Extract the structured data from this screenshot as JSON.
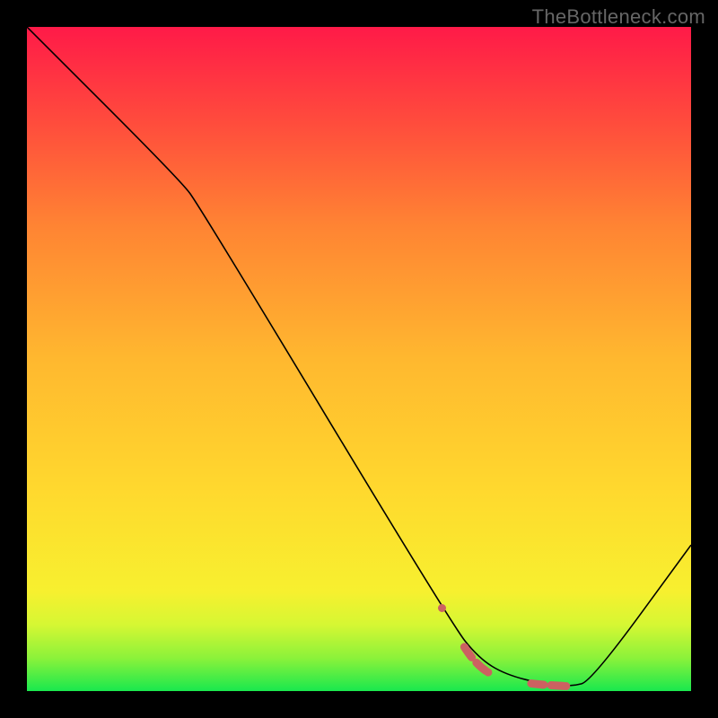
{
  "watermark": "TheBottleneck.com",
  "chart_data": {
    "type": "line",
    "title": "",
    "xlabel": "",
    "ylabel": "",
    "xlim": [
      0,
      100
    ],
    "ylim": [
      0,
      100
    ],
    "gradient_stops": [
      {
        "offset": 0.0,
        "color": "#19e84e"
      },
      {
        "offset": 0.05,
        "color": "#8cf23a"
      },
      {
        "offset": 0.1,
        "color": "#d6f733"
      },
      {
        "offset": 0.15,
        "color": "#f7f02f"
      },
      {
        "offset": 0.3,
        "color": "#ffd92e"
      },
      {
        "offset": 0.5,
        "color": "#ffb82f"
      },
      {
        "offset": 0.7,
        "color": "#ff8433"
      },
      {
        "offset": 0.85,
        "color": "#ff4e3c"
      },
      {
        "offset": 1.0,
        "color": "#ff1a48"
      }
    ],
    "series": [
      {
        "name": "bottleneck-curve",
        "color": "#000000",
        "width": 1.6,
        "points": [
          {
            "x": 0,
            "y": 100
          },
          {
            "x": 23,
            "y": 77
          },
          {
            "x": 26,
            "y": 73
          },
          {
            "x": 64,
            "y": 10
          },
          {
            "x": 68,
            "y": 5
          },
          {
            "x": 72,
            "y": 2.5
          },
          {
            "x": 78,
            "y": 1.0
          },
          {
            "x": 82,
            "y": 0.7
          },
          {
            "x": 85,
            "y": 1.5
          },
          {
            "x": 100,
            "y": 22
          }
        ]
      },
      {
        "name": "highlight-segment",
        "color": "#cc6161",
        "width": 9,
        "dash": [
          3,
          14,
          8,
          14,
          50,
          0
        ],
        "dash_reverse": true,
        "points": [
          {
            "x": 62.5,
            "y": 12.5
          },
          {
            "x": 66,
            "y": 6.2
          },
          {
            "x": 68.5,
            "y": 3.3
          },
          {
            "x": 71,
            "y": 2.0
          },
          {
            "x": 74,
            "y": 1.4
          },
          {
            "x": 77,
            "y": 1.0
          },
          {
            "x": 80,
            "y": 0.8
          },
          {
            "x": 82,
            "y": 0.7
          }
        ]
      }
    ]
  }
}
